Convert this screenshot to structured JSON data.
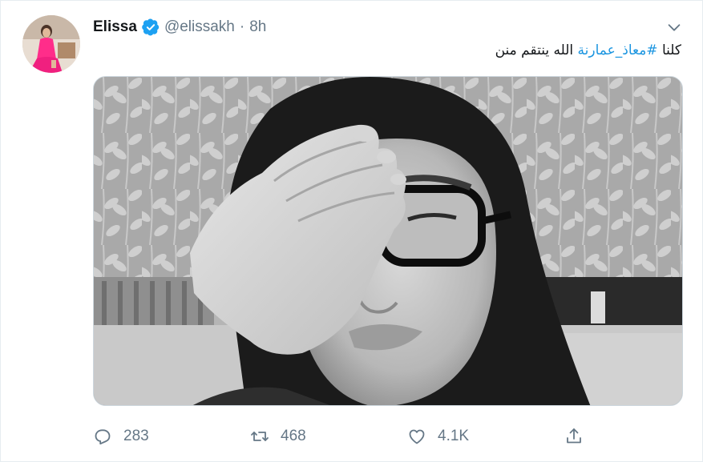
{
  "tweet": {
    "display_name": "Elissa",
    "handle": "@elissakh",
    "separator": "·",
    "time": "8h",
    "text_prefix": "كلنا ",
    "hashtag": "#معاذ_عمارنة",
    "text_suffix": " الله ينتقم منن",
    "icons": {
      "verified": "verified-badge-icon",
      "caret": "chevron-down-icon",
      "reply": "reply-icon",
      "retweet": "retweet-icon",
      "like": "heart-icon",
      "share": "share-icon"
    },
    "colors": {
      "name": "#14171a",
      "secondary": "#657786",
      "hashtag": "#1b95e0",
      "verified": "#1da1f2"
    }
  },
  "stats": {
    "replies": "283",
    "retweets": "468",
    "likes": "4.1K"
  }
}
